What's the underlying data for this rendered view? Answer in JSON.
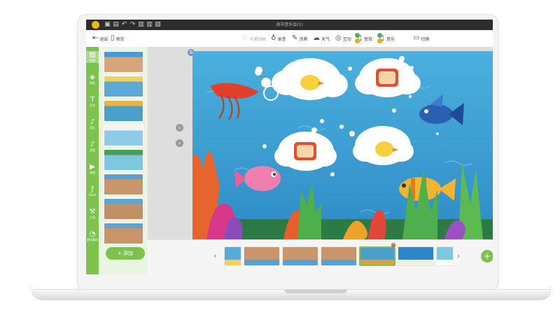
{
  "window": {
    "title": "海洋音乐会(1)"
  },
  "titlebar_icons": [
    "save-icon",
    "folder-icon",
    "undo-icon",
    "redo-icon",
    "doc-icon",
    "doc-icon",
    "image-icon"
  ],
  "toolbar": {
    "left": [
      {
        "name": "back-button",
        "icon": "back-icon",
        "label": "退出"
      },
      {
        "name": "preview-button",
        "icon": "book-icon",
        "label": "预览"
      }
    ],
    "tools": [
      {
        "name": "tool-animation",
        "icon": "star-icon",
        "label": "卡通动画",
        "dim": true
      },
      {
        "name": "tool-record",
        "icon": "mic-icon",
        "label": "录音"
      },
      {
        "name": "tool-paint",
        "icon": "brush-icon",
        "label": "涂鸦"
      },
      {
        "name": "tool-weather",
        "icon": "weather-icon",
        "label": "天气"
      },
      {
        "name": "tool-interact",
        "icon": "pin-icon",
        "label": "互动"
      },
      {
        "name": "tool-sound",
        "icon": "music-icon",
        "label": "音效"
      },
      {
        "name": "tool-music",
        "icon": "music-icon",
        "label": "音乐"
      },
      {
        "name": "tool-transition",
        "icon": "transition-icon",
        "label": "切换"
      }
    ]
  },
  "rail": [
    {
      "name": "rail-background",
      "icon": "image-icon",
      "label": "背景",
      "active": true
    },
    {
      "name": "rail-character",
      "icon": "cube-icon",
      "label": "角色"
    },
    {
      "name": "rail-text",
      "icon": "text-icon",
      "label": "文字"
    },
    {
      "name": "rail-music",
      "icon": "note-icon",
      "label": "音乐"
    },
    {
      "name": "rail-sound",
      "icon": "note-icon",
      "label": "音效"
    },
    {
      "name": "rail-video",
      "icon": "video-icon",
      "label": "视频"
    },
    {
      "name": "rail-flash",
      "icon": "flash-icon",
      "label": "Flash"
    },
    {
      "name": "rail-tools",
      "icon": "tool-icon",
      "label": "工具"
    },
    {
      "name": "rail-more",
      "icon": "more-icon",
      "label": "更多素材"
    }
  ],
  "slides": {
    "add_label": "+ 添加",
    "thumbs": [
      {
        "bg": "#d7a57a",
        "accent": "#4a9bd1"
      },
      {
        "bg": "#5aa9d6",
        "accent": "#f2d15c"
      },
      {
        "bg": "#4aa0c8",
        "accent": "#f0b040"
      },
      {
        "bg": "#8ecbe8",
        "accent": "#f3f3f3"
      },
      {
        "bg": "#7fc6df",
        "accent": "#4c9a5a"
      },
      {
        "bg": "#c9956a",
        "accent": "#5a9fd0"
      },
      {
        "bg": "#c29066",
        "accent": "#5aa5d6"
      },
      {
        "bg": "#c9946a",
        "accent": "#5aa5d6"
      }
    ]
  },
  "filmstrip": {
    "thumbs": [
      {
        "bg": "#5aa9d6",
        "accent": "#f2d15c",
        "wide": false
      },
      {
        "bg": "#c9956a",
        "accent": "#5a9fd0",
        "wide": true
      },
      {
        "bg": "#c9956a",
        "accent": "#5a9fd0",
        "wide": true
      },
      {
        "bg": "#c9956a",
        "accent": "#5a9fd0",
        "wide": true
      },
      {
        "bg": "#4aa0c8",
        "accent": "#e89b3a",
        "wide": true,
        "selected": true
      },
      {
        "bg": "#2f86c4",
        "accent": "#f3efe0",
        "wide": true
      },
      {
        "bg": "#7fc6df",
        "accent": "#ffffff",
        "wide": false
      }
    ]
  },
  "colors": {
    "accent": "#7dc24f",
    "sea": "#3f9fd0"
  }
}
